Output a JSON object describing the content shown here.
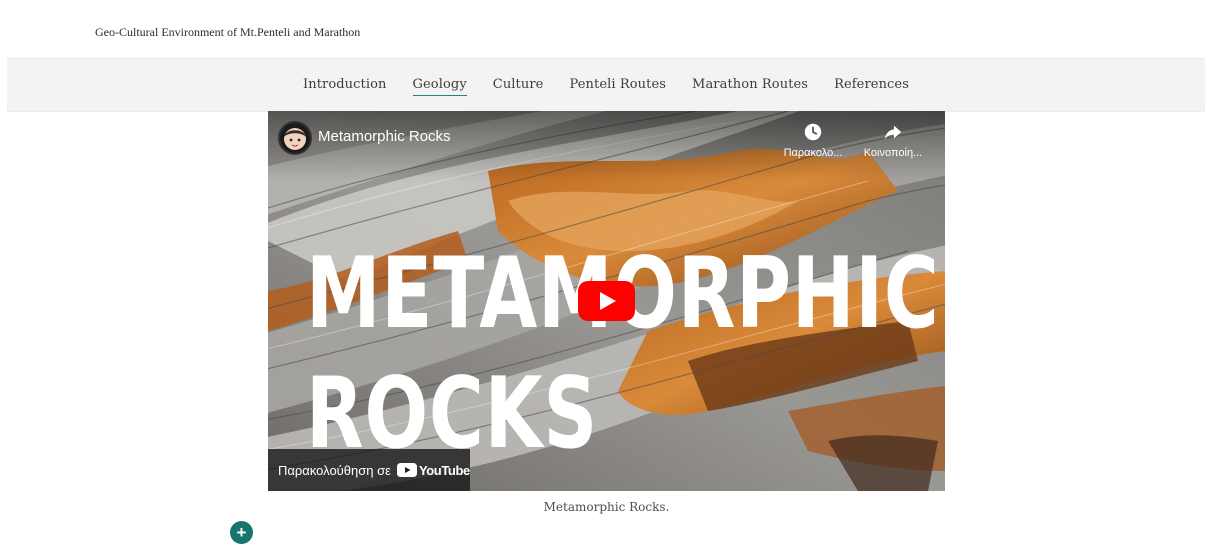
{
  "site": {
    "title": "Geo-Cultural Environment of Mt.Penteli and Marathon"
  },
  "nav": {
    "items": [
      {
        "label": "Introduction",
        "active": false
      },
      {
        "label": "Geology",
        "active": true
      },
      {
        "label": "Culture",
        "active": false
      },
      {
        "label": "Penteli Routes",
        "active": false
      },
      {
        "label": "Marathon Routes",
        "active": false
      },
      {
        "label": "References",
        "active": false
      }
    ]
  },
  "video": {
    "title": "Metamorphic Rocks",
    "thumbnail_line1": "METAMORPHIC",
    "thumbnail_line2": "ROCKS",
    "watch_later_label": "Παρακολο...",
    "share_label": "Κοινοποίη...",
    "watch_on_label": "Παρακολούθηση σε",
    "youtube_label": "YouTube",
    "icons": {
      "avatar": "channel-avatar",
      "watch_later": "clock-icon",
      "share": "share-arrow-icon",
      "play": "play-icon",
      "youtube": "youtube-logo-icon"
    },
    "colors": {
      "play_red": "#ff0000"
    }
  },
  "caption": {
    "text": "Metamorphic Rocks."
  },
  "add_button": {
    "icon": "plus-icon",
    "symbol": "+",
    "color": "#16756f"
  }
}
